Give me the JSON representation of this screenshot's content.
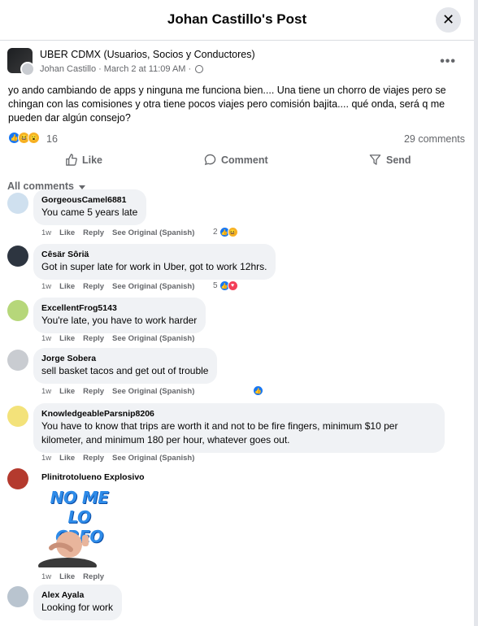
{
  "header": {
    "title": "Johan Castillo's Post",
    "close_icon": "close-icon"
  },
  "post": {
    "group_name": "UBER CDMX (Usuarios, Socios y Conductores)",
    "author": "Johan Castillo",
    "date": "March 2 at 11:09 AM",
    "separator": "·",
    "text": "yo ando cambiando de apps y ninguna me funciona bien.... Una tiene un chorro de viajes pero se chingan con las comisiones y otra tiene pocos viajes pero comisión bajita.... qué onda, será q me pueden dar algún consejo?",
    "reactions": [
      "like",
      "haha",
      "wow"
    ],
    "reaction_count": "16",
    "comment_count": "29 comments"
  },
  "actions": {
    "like": "Like",
    "comment": "Comment",
    "send": "Send"
  },
  "comments_filter": "All comments",
  "comment_action_labels": {
    "like": "Like",
    "reply": "Reply",
    "see_original": "See Original (Spanish)"
  },
  "comments": [
    {
      "author": "GorgeousCamel6881",
      "text": "You came 5 years late",
      "time": "1w",
      "reaction_count": "2",
      "reactions": [
        "like",
        "haha"
      ]
    },
    {
      "author": "Cêsär Sôriä",
      "text": "Got in super late for work in Uber, got to work 12hrs.",
      "time": "1w",
      "reaction_count": "5",
      "reactions": [
        "like",
        "love"
      ]
    },
    {
      "author": "ExcellentFrog5143",
      "text": "You're late, you have to work harder",
      "time": "1w"
    },
    {
      "author": "Jorge Sobera",
      "text": "sell basket tacos and get out of trouble",
      "time": "1w",
      "reactions": [
        "like"
      ]
    },
    {
      "author": "KnowledgeableParsnip8206",
      "text": "You have to know that trips are worth it and not to be fire fingers, minimum $10 per kilometer, and minimum 180 per hour, whatever goes out.",
      "time": "1w"
    },
    {
      "author": "Plinitrotolueno Explosivo",
      "sticker_text": "NO ME LO CREO",
      "time": "1w"
    },
    {
      "author": "Alex Ayala",
      "text": "Looking for work"
    }
  ],
  "colors": {
    "accent": "#1877f2",
    "bubble": "#f0f2f5",
    "secondary_text": "#65676b"
  }
}
